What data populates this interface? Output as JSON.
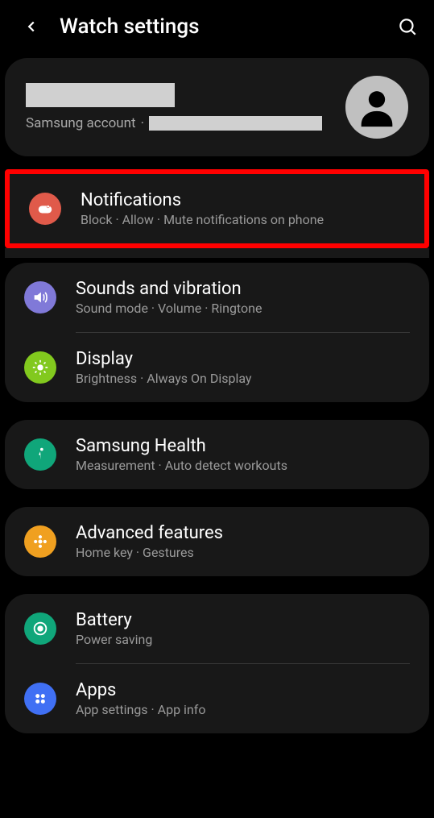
{
  "header": {
    "title": "Watch settings"
  },
  "account": {
    "label": "Samsung account",
    "separator": " · "
  },
  "highlightItem": {
    "title": "Notifications",
    "sub": "Block · Allow · Mute notifications on phone"
  },
  "group1": [
    {
      "title": "Sounds and vibration",
      "sub": "Sound mode · Volume · Ringtone"
    },
    {
      "title": "Display",
      "sub": "Brightness · Always On Display"
    }
  ],
  "group2": [
    {
      "title": "Samsung Health",
      "sub": "Measurement · Auto detect workouts"
    }
  ],
  "group3": [
    {
      "title": "Advanced features",
      "sub": "Home key · Gestures"
    }
  ],
  "group4": [
    {
      "title": "Battery",
      "sub": "Power saving"
    },
    {
      "title": "Apps",
      "sub": "App settings · App info"
    }
  ]
}
